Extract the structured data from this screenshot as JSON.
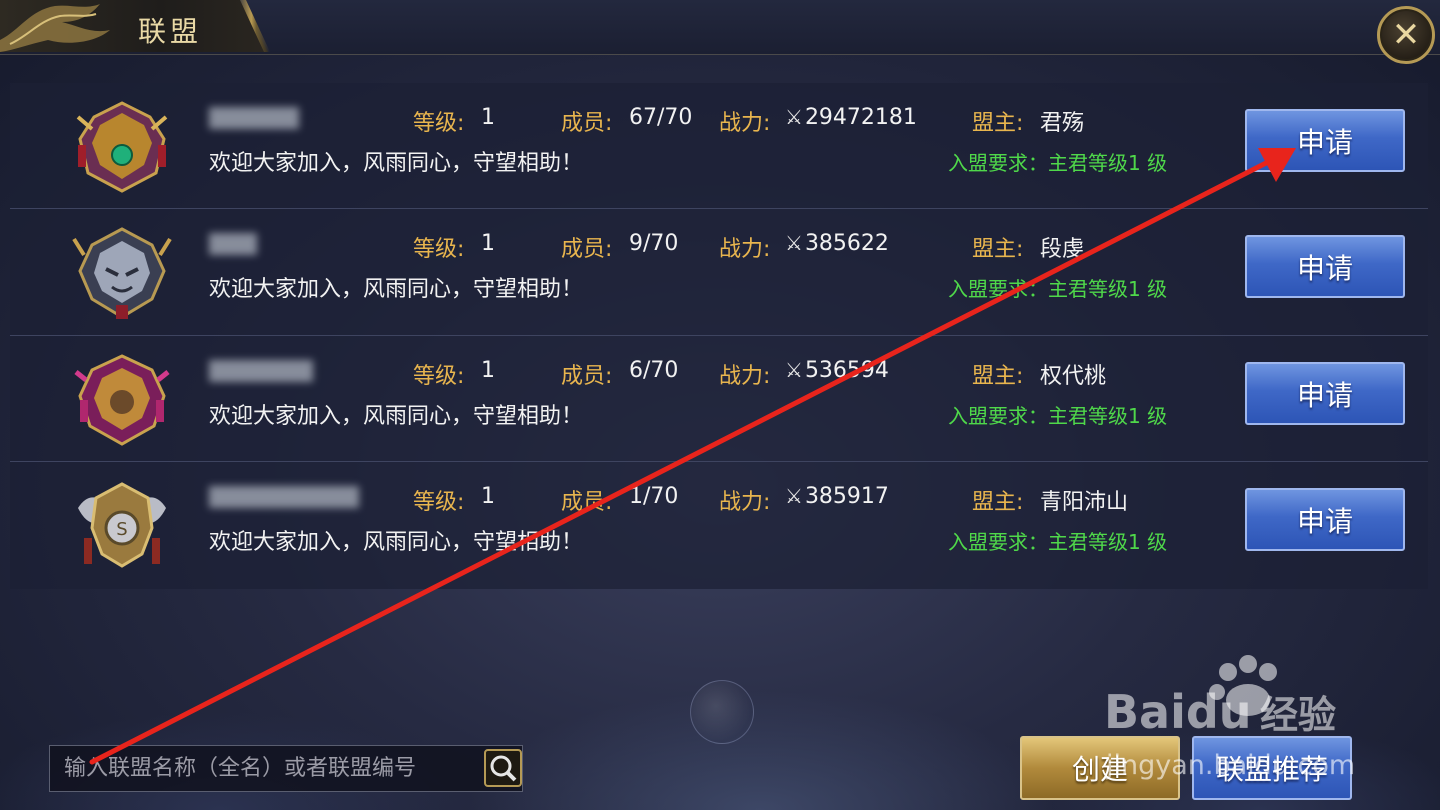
{
  "window": {
    "title": "联盟",
    "close_icon": "close-icon"
  },
  "labels": {
    "level": "等级:",
    "members": "成员:",
    "power": "战力:",
    "leader": "盟主:",
    "apply": "申请"
  },
  "alliances": [
    {
      "level": "1",
      "members": "67/70",
      "power": "29472181",
      "leader": "君殇",
      "description": "欢迎大家加入，风雨同心，守望相助！",
      "requirement": "入盟要求：主君等级1 级",
      "emblem": "dragon-emblem-gold"
    },
    {
      "level": "1",
      "members": "9/70",
      "power": "385622",
      "leader": "段虔",
      "description": "欢迎大家加入，风雨同心，守望相助！",
      "requirement": "入盟要求：主君等级1 级",
      "emblem": "tiger-emblem-silver"
    },
    {
      "level": "1",
      "members": "6/70",
      "power": "536594",
      "leader": "权代桃",
      "description": "欢迎大家加入，风雨同心，守望相助！",
      "requirement": "入盟要求：主君等级1 级",
      "emblem": "lion-emblem-magenta"
    },
    {
      "level": "1",
      "members": "1/70",
      "power": "385917",
      "leader": "青阳沛山",
      "description": "欢迎大家加入，风雨同心，守望相助！",
      "requirement": "入盟要求：主君等级1 级",
      "emblem": "axe-emblem-bronze"
    }
  ],
  "search": {
    "placeholder": "输入联盟名称（全名）或者联盟编号",
    "icon": "magnifier-icon"
  },
  "buttons": {
    "create": "创建",
    "recommend": "联盟推荐"
  },
  "watermark": {
    "brand": "Baidu",
    "suffix": "经验",
    "url": "jingyan.baidu.com"
  },
  "colors": {
    "label_gold": "#e8b54e",
    "requirement_green": "#4fd84a",
    "button_blue": "#3f68c7",
    "button_gold": "#b18a3c",
    "arrow_red": "#e8241c"
  }
}
